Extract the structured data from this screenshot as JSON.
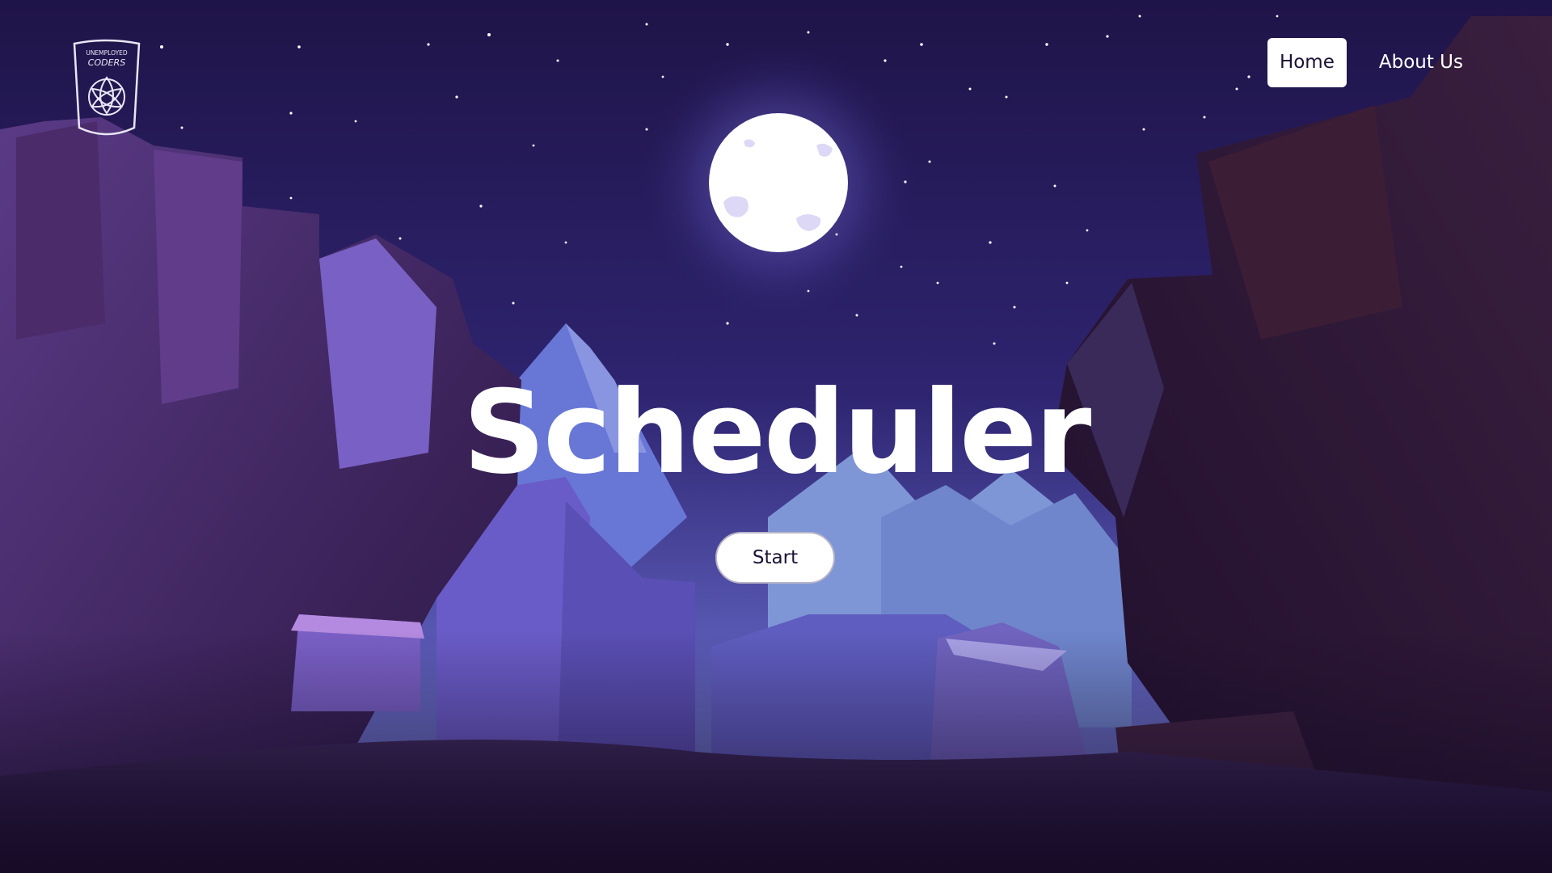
{
  "logo": {
    "line1": "UNEMPLOYED",
    "line2": "CODERS",
    "icon": "triquetra-icon"
  },
  "nav": {
    "items": [
      {
        "label": "Home",
        "active": true
      },
      {
        "label": "About Us",
        "active": false
      }
    ]
  },
  "hero": {
    "title": "Scheduler",
    "cta_label": "Start"
  },
  "colors": {
    "sky_top": "#1f1448",
    "sky_bottom": "#4a48a8",
    "moon": "#ffffff",
    "cliff": "#3c2560",
    "mountain": "#6a74d4",
    "text": "#ffffff"
  }
}
